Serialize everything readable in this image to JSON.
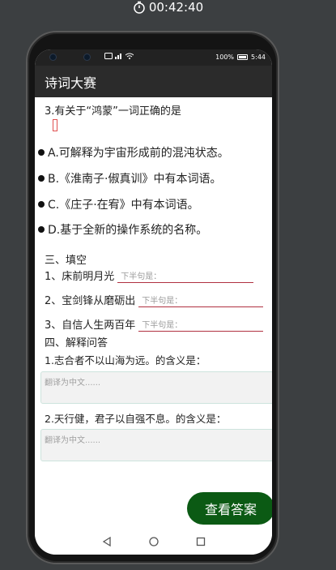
{
  "recording": {
    "time": "00:42:40"
  },
  "status_bar": {
    "left_icons": "NFC · 4G · signal · wifi",
    "battery_text": "100%",
    "clock": "5:44"
  },
  "app": {
    "title": "诗词大赛"
  },
  "question": {
    "title": "3.有关于“鸿蒙”一词正确的是",
    "options": [
      {
        "label": "A.可解释为宇宙形成前的混沌状态。"
      },
      {
        "label": "B.《淮南子·俶真训》中有本词语。"
      },
      {
        "label": "C.《庄子·在宥》中有本词语。"
      },
      {
        "label": "D.基于全新的操作系统的名称。"
      }
    ]
  },
  "fill_section": {
    "heading": "三、填空",
    "items": [
      {
        "prompt": "1、床前明月光",
        "placeholder": "下半句是："
      },
      {
        "prompt": "2、宝剑锋从磨砺出",
        "placeholder": "下半句是："
      },
      {
        "prompt": "3、自信人生两百年",
        "placeholder": "下半句是："
      }
    ]
  },
  "qa_section": {
    "heading": "四、解释问答",
    "items": [
      {
        "prompt": "1.志合者不以山海为远。的含义是：",
        "placeholder": "翻译为中文......"
      },
      {
        "prompt": "2.天行健，君子以自强不息。的含义是：",
        "placeholder": "翻译为中文......"
      }
    ]
  },
  "answer_button": {
    "label": "查看答案",
    "color": "#0b5a14"
  },
  "colors": {
    "app_bar": "#2b2b2b",
    "underline": "#b03040"
  }
}
